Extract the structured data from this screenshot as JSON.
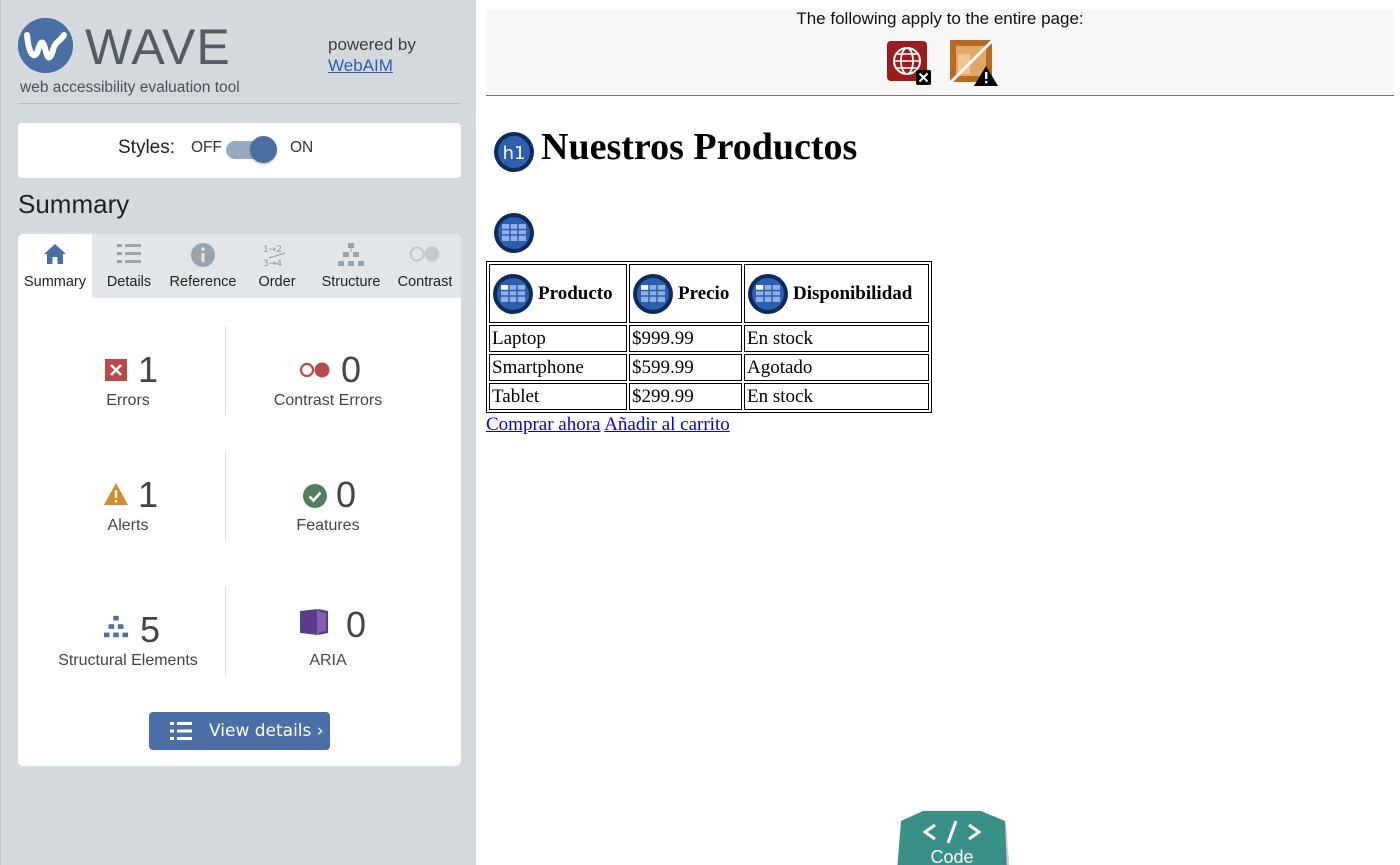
{
  "brand": {
    "name": "WAVE",
    "tagline": "web accessibility evaluation tool",
    "powered_by": "powered by",
    "powered_link": "WebAIM"
  },
  "styles_toggle": {
    "label": "Styles:",
    "off": "OFF",
    "on": "ON",
    "state": "on"
  },
  "summary_heading": "Summary",
  "tabs": [
    {
      "label": "Summary",
      "icon": "home-icon",
      "active": true
    },
    {
      "label": "Details",
      "icon": "list-icon",
      "active": false
    },
    {
      "label": "Reference",
      "icon": "info-icon",
      "active": false
    },
    {
      "label": "Order",
      "icon": "order-icon",
      "active": false
    },
    {
      "label": "Structure",
      "icon": "structure-icon",
      "active": false
    },
    {
      "label": "Contrast",
      "icon": "contrast-icon",
      "active": false
    }
  ],
  "stats": {
    "errors": {
      "count": "1",
      "label": "Errors"
    },
    "contrast_errors": {
      "count": "0",
      "label": "Contrast Errors"
    },
    "alerts": {
      "count": "1",
      "label": "Alerts"
    },
    "features": {
      "count": "0",
      "label": "Features"
    },
    "structural": {
      "count": "5",
      "label": "Structural Elements"
    },
    "aria": {
      "count": "0",
      "label": "ARIA"
    }
  },
  "view_details": "View details ›",
  "page": {
    "banner": "The following apply to the entire page:",
    "banner_icons": [
      "language-missing-error-icon",
      "no-page-regions-alert-icon"
    ],
    "h1_badge": "h1",
    "heading": "Nuestros Productos",
    "table": {
      "headers": [
        "Producto",
        "Precio",
        "Disponibilidad"
      ],
      "rows": [
        [
          "Laptop",
          "$999.99",
          "En stock"
        ],
        [
          "Smartphone",
          "$599.99",
          "Agotado"
        ],
        [
          "Tablet",
          "$299.99",
          "En stock"
        ]
      ]
    },
    "links": [
      "Comprar ahora",
      "Añadir al carrito"
    ]
  },
  "code_toggle": "Code",
  "colors": {
    "sidebar_bg": "#d4d9de",
    "brand_blue": "#4a6fa5",
    "error_red": "#b94a48",
    "alert_orange": "#d68a2e",
    "feature_green": "#4f7f5f",
    "aria_purple": "#5b3d8a",
    "code_teal": "#3a8f87"
  }
}
